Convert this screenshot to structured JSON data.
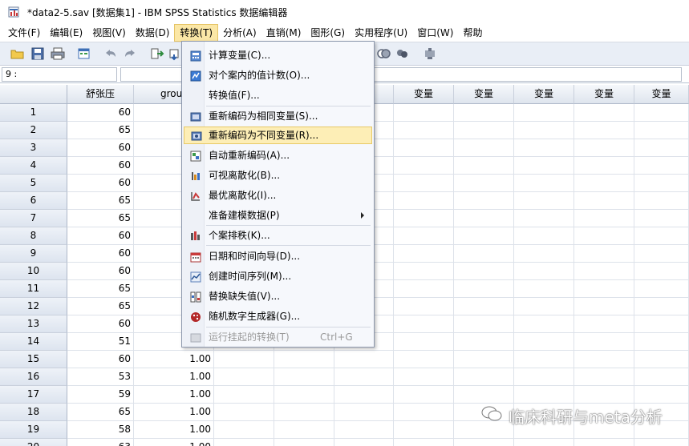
{
  "window": {
    "title": "*data2-5.sav [数据集1] - IBM SPSS Statistics 数据编辑器"
  },
  "menubar": {
    "items": [
      "文件(F)",
      "编辑(E)",
      "视图(V)",
      "数据(D)",
      "转换(T)",
      "分析(A)",
      "直销(M)",
      "图形(G)",
      "实用程序(U)",
      "窗口(W)",
      "帮助"
    ],
    "active_index": 4
  },
  "refbar": {
    "cell_reference": "9 :"
  },
  "grid": {
    "columns": [
      "舒张压",
      "grou",
      "",
      "变量",
      "变量",
      "变量",
      "变量",
      "变量",
      "变量"
    ],
    "rows": [
      {
        "num": "1",
        "v1": "60",
        "v2": ""
      },
      {
        "num": "2",
        "v1": "65",
        "v2": ""
      },
      {
        "num": "3",
        "v1": "60",
        "v2": ""
      },
      {
        "num": "4",
        "v1": "60",
        "v2": ""
      },
      {
        "num": "5",
        "v1": "60",
        "v2": ""
      },
      {
        "num": "6",
        "v1": "65",
        "v2": ""
      },
      {
        "num": "7",
        "v1": "65",
        "v2": ""
      },
      {
        "num": "8",
        "v1": "60",
        "v2": ""
      },
      {
        "num": "9",
        "v1": "60",
        "v2": ""
      },
      {
        "num": "10",
        "v1": "60",
        "v2": ""
      },
      {
        "num": "11",
        "v1": "65",
        "v2": ""
      },
      {
        "num": "12",
        "v1": "65",
        "v2": ""
      },
      {
        "num": "13",
        "v1": "60",
        "v2": ""
      },
      {
        "num": "14",
        "v1": "51",
        "v2": ""
      },
      {
        "num": "15",
        "v1": "60",
        "v2": "1.00"
      },
      {
        "num": "16",
        "v1": "53",
        "v2": "1.00"
      },
      {
        "num": "17",
        "v1": "59",
        "v2": "1.00"
      },
      {
        "num": "18",
        "v1": "65",
        "v2": "1.00"
      },
      {
        "num": "19",
        "v1": "58",
        "v2": "1.00"
      },
      {
        "num": "20",
        "v1": "63",
        "v2": "1.00"
      }
    ]
  },
  "transform_menu": {
    "items": [
      {
        "label": "计算变量(C)...",
        "icon": "calculator-icon"
      },
      {
        "label": "对个案内的值计数(O)...",
        "icon": "count-values-icon"
      },
      {
        "label": "转换值(F)...",
        "icon": ""
      },
      {
        "label": "重新编码为相同变量(S)...",
        "icon": "recode-same-icon"
      },
      {
        "label": "重新编码为不同变量(R)...",
        "icon": "recode-different-icon",
        "highlighted": true
      },
      {
        "label": "自动重新编码(A)...",
        "icon": "automatic-recode-icon"
      },
      {
        "label": "可视离散化(B)...",
        "icon": "visual-binning-icon"
      },
      {
        "label": "最优离散化(I)...",
        "icon": "optimal-binning-icon"
      },
      {
        "label": "准备建模数据(P)",
        "icon": "",
        "submenu": true
      },
      {
        "label": "个案排秩(K)...",
        "icon": "rank-cases-icon"
      },
      {
        "label": "日期和时间向导(D)...",
        "icon": "date-time-wizard-icon"
      },
      {
        "label": "创建时间序列(M)...",
        "icon": "time-series-icon"
      },
      {
        "label": "替换缺失值(V)...",
        "icon": "replace-missing-icon"
      },
      {
        "label": "随机数字生成器(G)...",
        "icon": "random-generator-icon"
      },
      {
        "label": "运行挂起的转换(T)",
        "icon": "run-pending-icon",
        "disabled": true,
        "shortcut": "Ctrl+G"
      }
    ]
  },
  "watermark": {
    "text": "临床科研与meta分析"
  },
  "colors": {
    "menu_highlight": "#fdeeb6",
    "header_bg": "#dfe5ee",
    "toolbar_bg": "#e9eef6"
  }
}
